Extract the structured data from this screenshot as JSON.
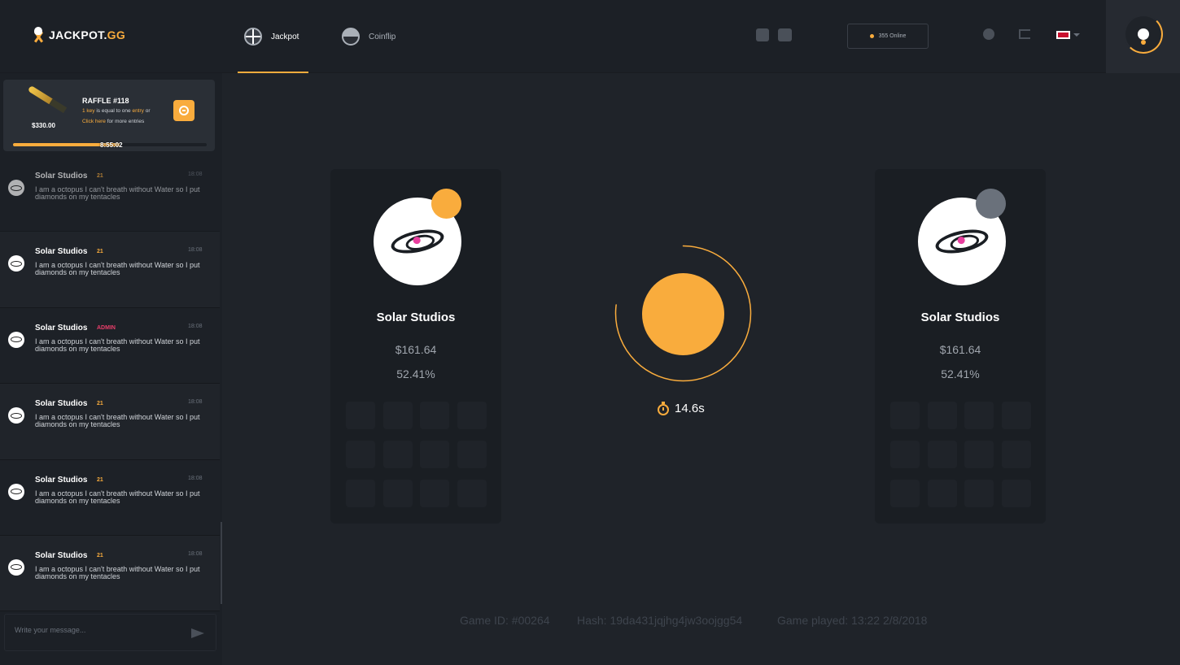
{
  "header": {
    "logo_main": "JACKPOT.",
    "logo_accent": "GG",
    "nav": [
      {
        "label": "Jackpot",
        "active": true
      },
      {
        "label": "Coinflip",
        "active": false
      }
    ],
    "online_text": "355 Online",
    "accent_color": "#f9ac3d"
  },
  "raffle": {
    "title": "RAFFLE #118",
    "price": "$330.00",
    "line1_prefix": "1 key",
    "line1_mid": " is equal to one ",
    "line1_entry": "entry",
    "line1_suffix": " or",
    "line2_link": "Click here",
    "line2_suffix": " for more entries",
    "timer": "8:55:02",
    "progress": 0.55
  },
  "chat": {
    "messages": [
      {
        "name": "Solar Studios",
        "badge": "21",
        "time": "18:08",
        "text": "I am a octopus I can't breath without Water so I put diamonds on my tentacles"
      },
      {
        "name": "Solar Studios",
        "badge": "21",
        "time": "18:08",
        "text": "I am a octopus I can't breath without Water so I put diamonds on my tentacles"
      },
      {
        "name": "Solar Studios",
        "badge": "ADMIN",
        "time": "18:08",
        "text": "I am a octopus I can't breath without Water so I put diamonds on my tentacles"
      },
      {
        "name": "Solar Studios",
        "badge": "21",
        "time": "18:08",
        "text": "I am a octopus I can't breath without Water so I put diamonds on my tentacles"
      },
      {
        "name": "Solar Studios",
        "badge": "21",
        "time": "18:08",
        "text": "I am a octopus I can't breath without Water so I put diamonds on my tentacles"
      },
      {
        "name": "Solar Studios",
        "badge": "21",
        "time": "18:08",
        "text": "I am a octopus I can't breath without Water so I put diamonds on my tentacles"
      }
    ],
    "input_placeholder": "Write your message..."
  },
  "game": {
    "players": [
      {
        "name": "Solar Studios",
        "amount": "$161.64",
        "percent": "52.41%",
        "status_color": "#f9ac3d"
      },
      {
        "name": "Solar Studios",
        "amount": "$161.64",
        "percent": "52.41%",
        "status_color": "#6a717b"
      }
    ],
    "countdown": "14.6s",
    "ring_progress": 0.77
  },
  "footer": {
    "game_id": "Game ID: #00264",
    "hash": "Hash: 19da431jqjhg4jw3oojgg54",
    "played": "Game played: 13:22 2/8/2018"
  }
}
